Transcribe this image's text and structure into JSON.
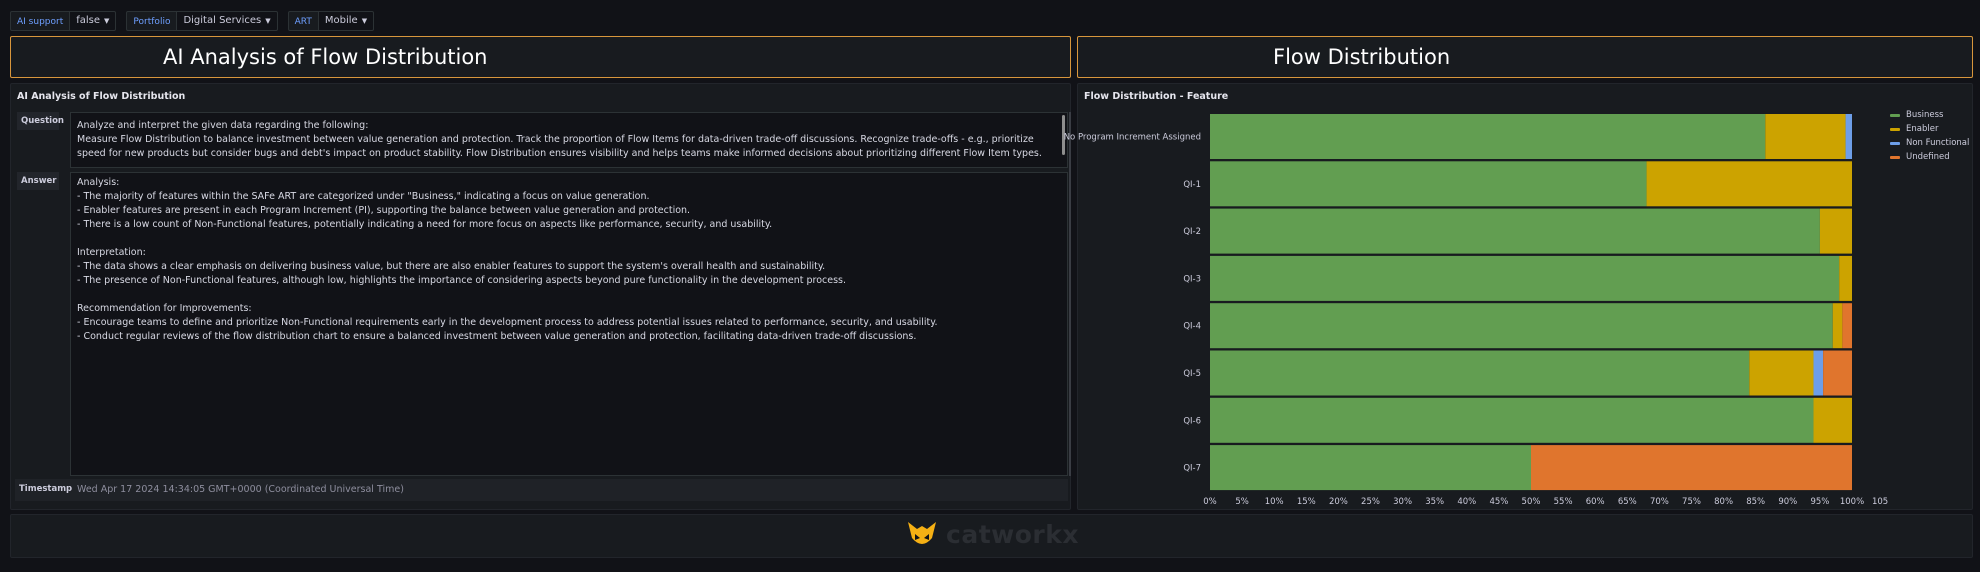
{
  "variables": [
    {
      "label": "AI support",
      "value": "false"
    },
    {
      "label": "Portfolio",
      "value": "Digital Services"
    },
    {
      "label": "ART",
      "value": "Mobile"
    }
  ],
  "left_title": "AI Analysis of Flow Distribution",
  "right_title": "Flow Distribution",
  "ai_panel": {
    "title": "AI Analysis of Flow Distribution",
    "question_label": "Question",
    "question_text": "Analyze and interpret the given data regarding the following:\nMeasure Flow Distribution to balance investment between value generation and protection. Track the proportion of Flow Items for data-driven trade-off discussions. Recognize trade-offs - e.g., prioritize speed for new products but consider bugs and debt's impact on product stability. Flow Distribution ensures visibility and helps teams make informed decisions about prioritizing different Flow Item types. Also give one or two short recommendations for",
    "answer_label": "Answer",
    "answer_text": "Analysis:\n- The majority of features within the SAFe ART are categorized under \"Business,\" indicating a focus on value generation.\n- Enabler features are present in each Program Increment (PI), supporting the balance between value generation and protection.\n- There is a low count of Non-Functional features, potentially indicating a need for more focus on aspects like performance, security, and usability.\n\nInterpretation:\n- The data shows a clear emphasis on delivering business value, but there are also enabler features to support the system's overall health and sustainability.\n- The presence of Non-Functional features, although low, highlights the importance of considering aspects beyond pure functionality in the development process.\n\nRecommendation for Improvements:\n- Encourage teams to define and prioritize Non-Functional requirements early in the development process to address potential issues related to performance, security, and usability.\n- Conduct regular reviews of the flow distribution chart to ensure a balanced investment between value generation and protection, facilitating data-driven trade-off discussions.",
    "timestamp_label": "Timestamp",
    "timestamp_value": "Wed Apr 17 2024 14:34:05 GMT+0000 (Coordinated Universal Time)"
  },
  "chart_panel": {
    "title": "Flow Distribution - Feature"
  },
  "logo_text": "catworkx",
  "chart_data": {
    "type": "bar",
    "orientation": "horizontal",
    "stacked": true,
    "percent": true,
    "categories": [
      "No Program Increment Assigned",
      "QI-1",
      "QI-2",
      "QI-3",
      "QI-4",
      "QI-5",
      "QI-6",
      "QI-7"
    ],
    "series": [
      {
        "name": "Business",
        "color": "#629e51",
        "values": [
          86.5,
          68,
          95,
          98,
          97,
          84,
          94,
          50
        ]
      },
      {
        "name": "Enabler",
        "color": "#cca300",
        "values": [
          12.5,
          32,
          5,
          2,
          1.5,
          10,
          6,
          0
        ]
      },
      {
        "name": "Non Functional",
        "color": "#6d9ee8",
        "values": [
          1,
          0,
          0,
          0,
          0,
          1.5,
          0,
          0
        ]
      },
      {
        "name": "Undefined",
        "color": "#e0752d",
        "values": [
          0,
          0,
          0,
          0,
          1.5,
          4.5,
          0,
          50
        ]
      }
    ],
    "xlim": [
      0,
      105
    ],
    "xticks": [
      "0%",
      "5%",
      "10%",
      "15%",
      "20%",
      "25%",
      "30%",
      "35%",
      "40%",
      "45%",
      "50%",
      "55%",
      "60%",
      "65%",
      "70%",
      "75%",
      "80%",
      "85%",
      "90%",
      "95%",
      "100%",
      "105%"
    ],
    "legend_position": "right"
  }
}
